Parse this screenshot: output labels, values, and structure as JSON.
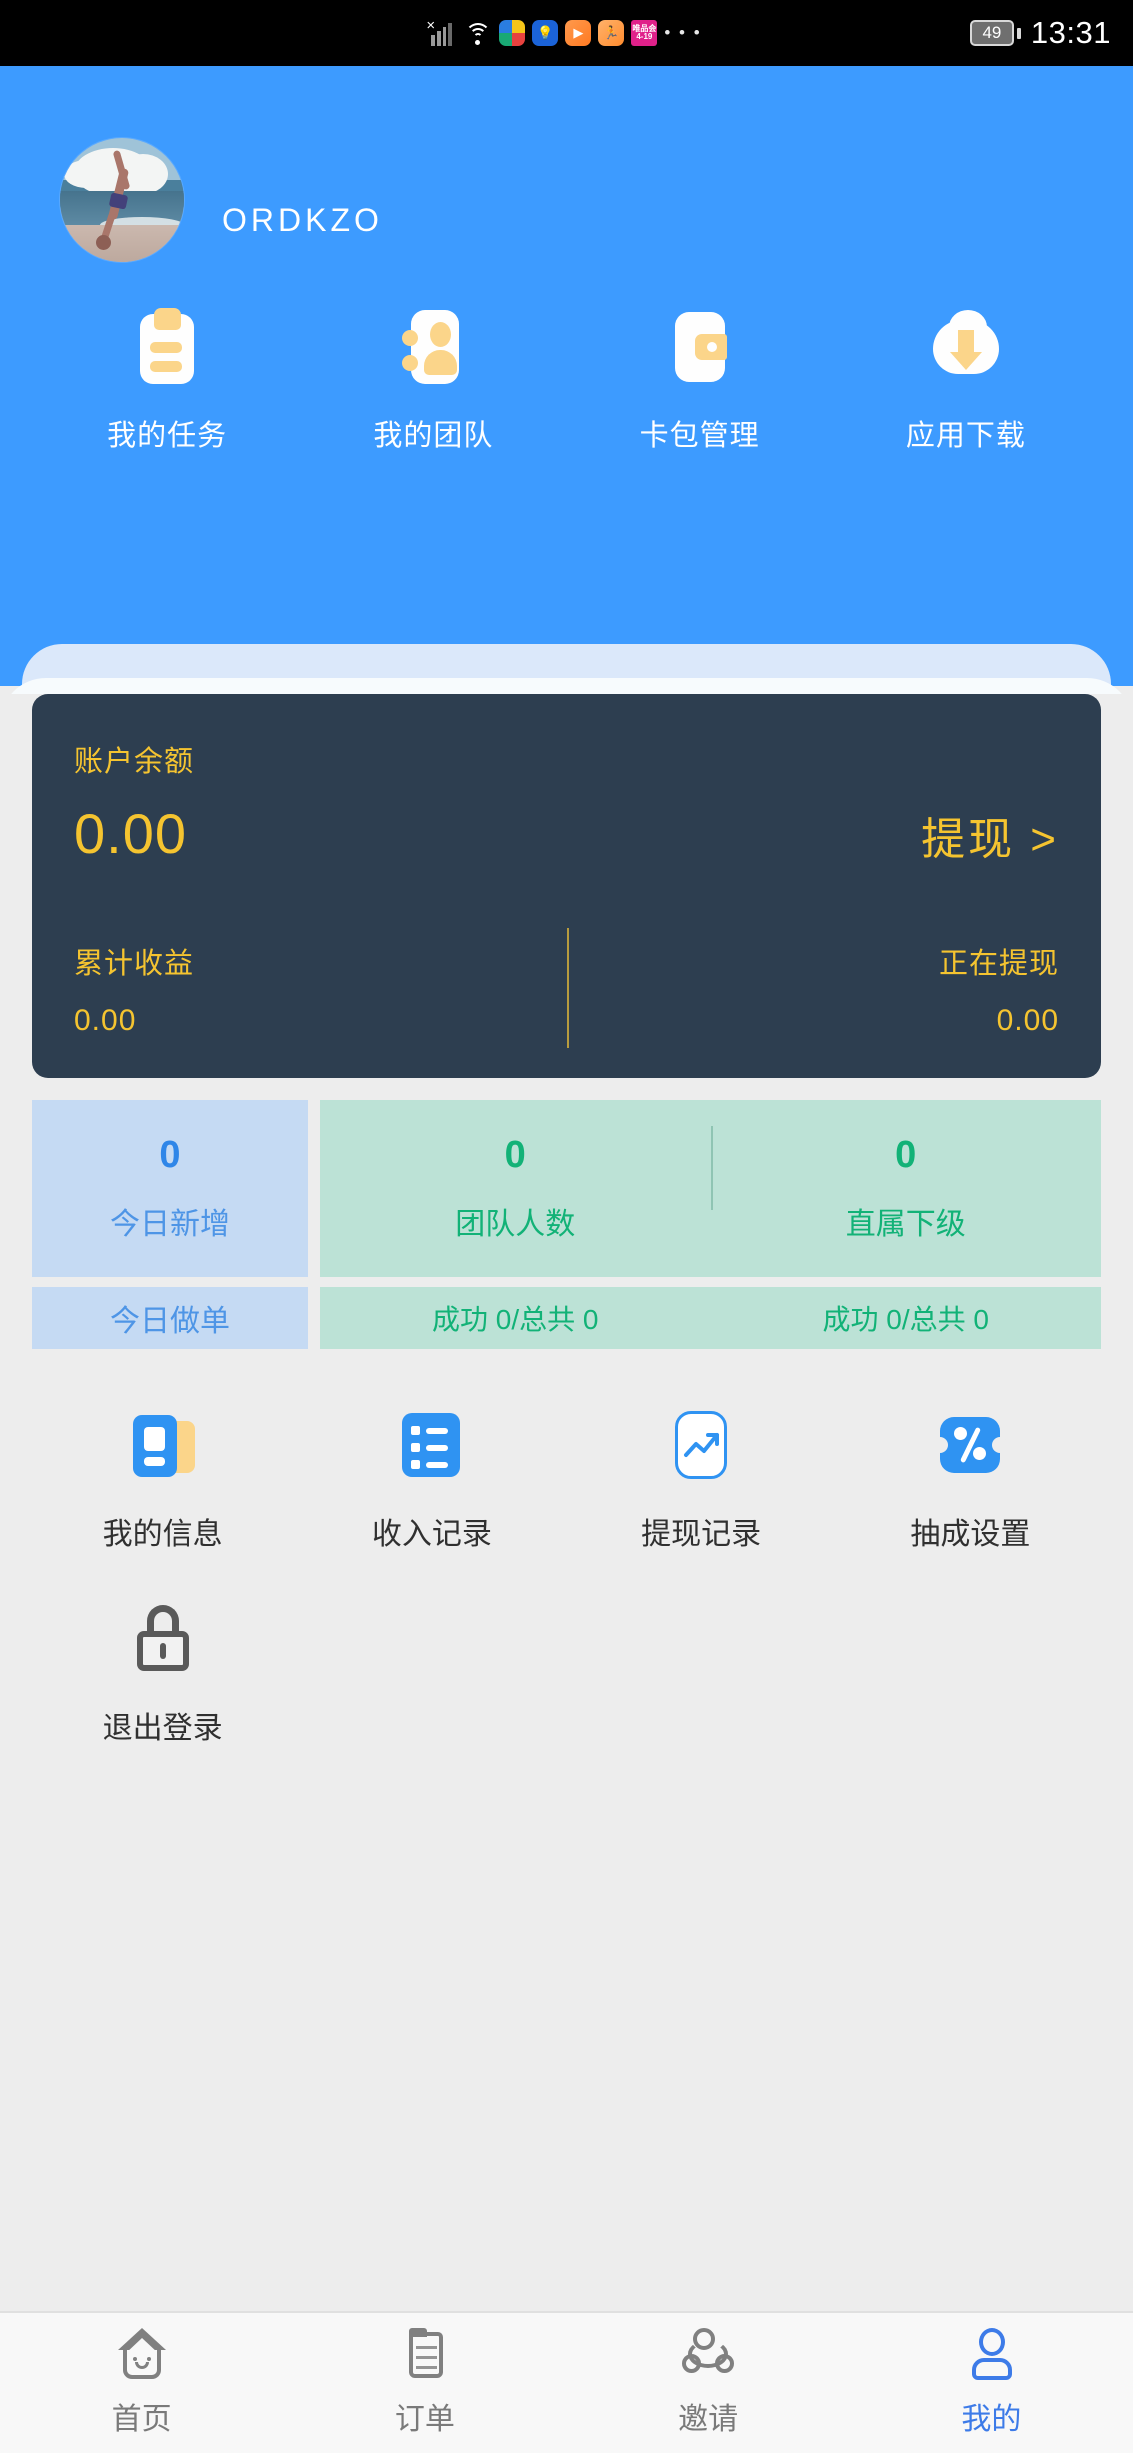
{
  "status_bar": {
    "time": "13:31",
    "battery_level": "49",
    "icons": [
      "signal-x-icon",
      "wifi-icon",
      "color-app-icon",
      "bulb-app-icon",
      "play-app-icon",
      "run-app-icon",
      "vip-app-icon",
      "more-dots-icon"
    ],
    "vip_line1": "唯品会",
    "vip_line2": "4-19",
    "more": "• • •"
  },
  "header": {
    "username": "ORDKZO",
    "avatar_alt": "beach-handstand-photo",
    "quick_actions": [
      {
        "label": "我的任务",
        "icon": "clipboard-icon"
      },
      {
        "label": "我的团队",
        "icon": "contacts-icon"
      },
      {
        "label": "卡包管理",
        "icon": "wallet-icon"
      },
      {
        "label": "应用下载",
        "icon": "cloud-download-icon"
      }
    ]
  },
  "balance_card": {
    "label": "账户余额",
    "amount": "0.00",
    "withdraw_label": "提现 >",
    "cumulative": {
      "label": "累计收益",
      "value": "0.00"
    },
    "pending": {
      "label": "正在提现",
      "value": "0.00"
    }
  },
  "stats": {
    "today_new": {
      "value": "0",
      "label": "今日新增"
    },
    "team_total": {
      "value": "0",
      "label": "团队人数"
    },
    "direct_sub": {
      "value": "0",
      "label": "直属下级"
    },
    "today_orders_label": "今日做单",
    "team_orders_text": "成功 0/总共 0",
    "direct_orders_text": "成功 0/总共 0"
  },
  "features": [
    {
      "label": "我的信息",
      "icon": "id-card-icon"
    },
    {
      "label": "收入记录",
      "icon": "list-icon"
    },
    {
      "label": "提现记录",
      "icon": "trend-chart-icon"
    },
    {
      "label": "抽成设置",
      "icon": "percent-icon"
    },
    {
      "label": "退出登录",
      "icon": "lock-icon"
    }
  ],
  "tabbar": [
    {
      "label": "首页",
      "icon": "home-icon",
      "active": false
    },
    {
      "label": "订单",
      "icon": "document-icon",
      "active": false
    },
    {
      "label": "邀请",
      "icon": "share-icon",
      "active": false
    },
    {
      "label": "我的",
      "icon": "person-icon",
      "active": true
    }
  ],
  "colors": {
    "header_blue": "#3D9BFF",
    "card_dark": "#2D3E50",
    "gold": "#F5C430",
    "stat_blue_bg": "#C5DAF3",
    "stat_green_bg": "#BCE2D6",
    "accent_blue": "#2F93F2",
    "accent_green": "#12B277",
    "tab_active": "#3D7BE8"
  }
}
